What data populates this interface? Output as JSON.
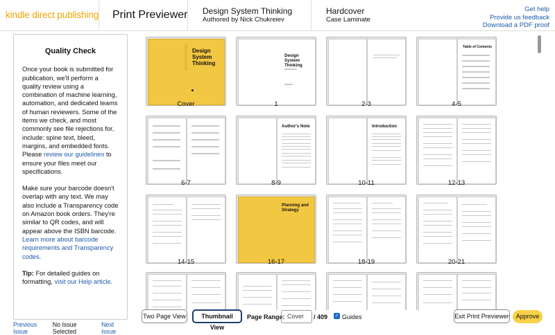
{
  "header": {
    "logo": "kindle direct publishing",
    "title": "Print Previewer",
    "book_title": "Design System Thinking",
    "book_author": "Authored by Nick Chukreiev",
    "format": "Hardcover",
    "format_sub": "Case Laminate",
    "links": [
      "Get help",
      "Provide us feedback",
      "Download a PDF proof"
    ]
  },
  "quality_check": {
    "title": "Quality Check",
    "p1_pre": "Once your book is submitted for publication, we'll perform a quality review using a combination of machine learning, automation, and dedicated teams of human reviewers. Some of the items we check, and most commonly see file rejections for, include: spine text, bleed, margins, and embedded fonts. Please ",
    "p1_link": "review our guidelines",
    "p1_post": " to ensure your files meet our specifications.",
    "p2_text": "Make sure your barcode doesn't overlap with any text. We may also include a Transparency code on Amazon book orders. They're similar to QR codes, and will appear above the ISBN barcode. ",
    "p2_link": "Learn more about barcode requirements and Transparency codes.",
    "tip_label": "Tip:",
    "tip_text": " For detailed guides on formatting, ",
    "tip_link": "visit our Help article",
    "tip_end": "."
  },
  "issue_nav": {
    "prev": "Previous Issue",
    "status": "No Issue Selected",
    "next": "Next Issue"
  },
  "thumbnails": {
    "captions": [
      "Cover",
      "1",
      "2-3",
      "4-5",
      "6-7",
      "8-9",
      "10-11",
      "12-13",
      "14-15",
      "16-17",
      "18-19",
      "20-21"
    ],
    "cover_title": "Design System Thinking",
    "page1_title": "Design System Thinking",
    "toc_title": "Table of Contents",
    "authors_note": "Author's Note",
    "introduction": "Introduction",
    "planning": "Planning and Strategy"
  },
  "toolbar": {
    "two_page": "Two Page View",
    "thumbnail": "Thumbnail View",
    "page_range_label": "Page Range:",
    "page_range_value": "Cover",
    "total_pages": "/ 409",
    "guides": "Guides",
    "exit": "Exit Print Previewer",
    "approve": "Approve"
  },
  "colors": {
    "accent_link": "#1a5aa8",
    "logo": "#f0a500",
    "cover_yellow": "#f2c741",
    "approve_yellow": "#f7d147"
  }
}
